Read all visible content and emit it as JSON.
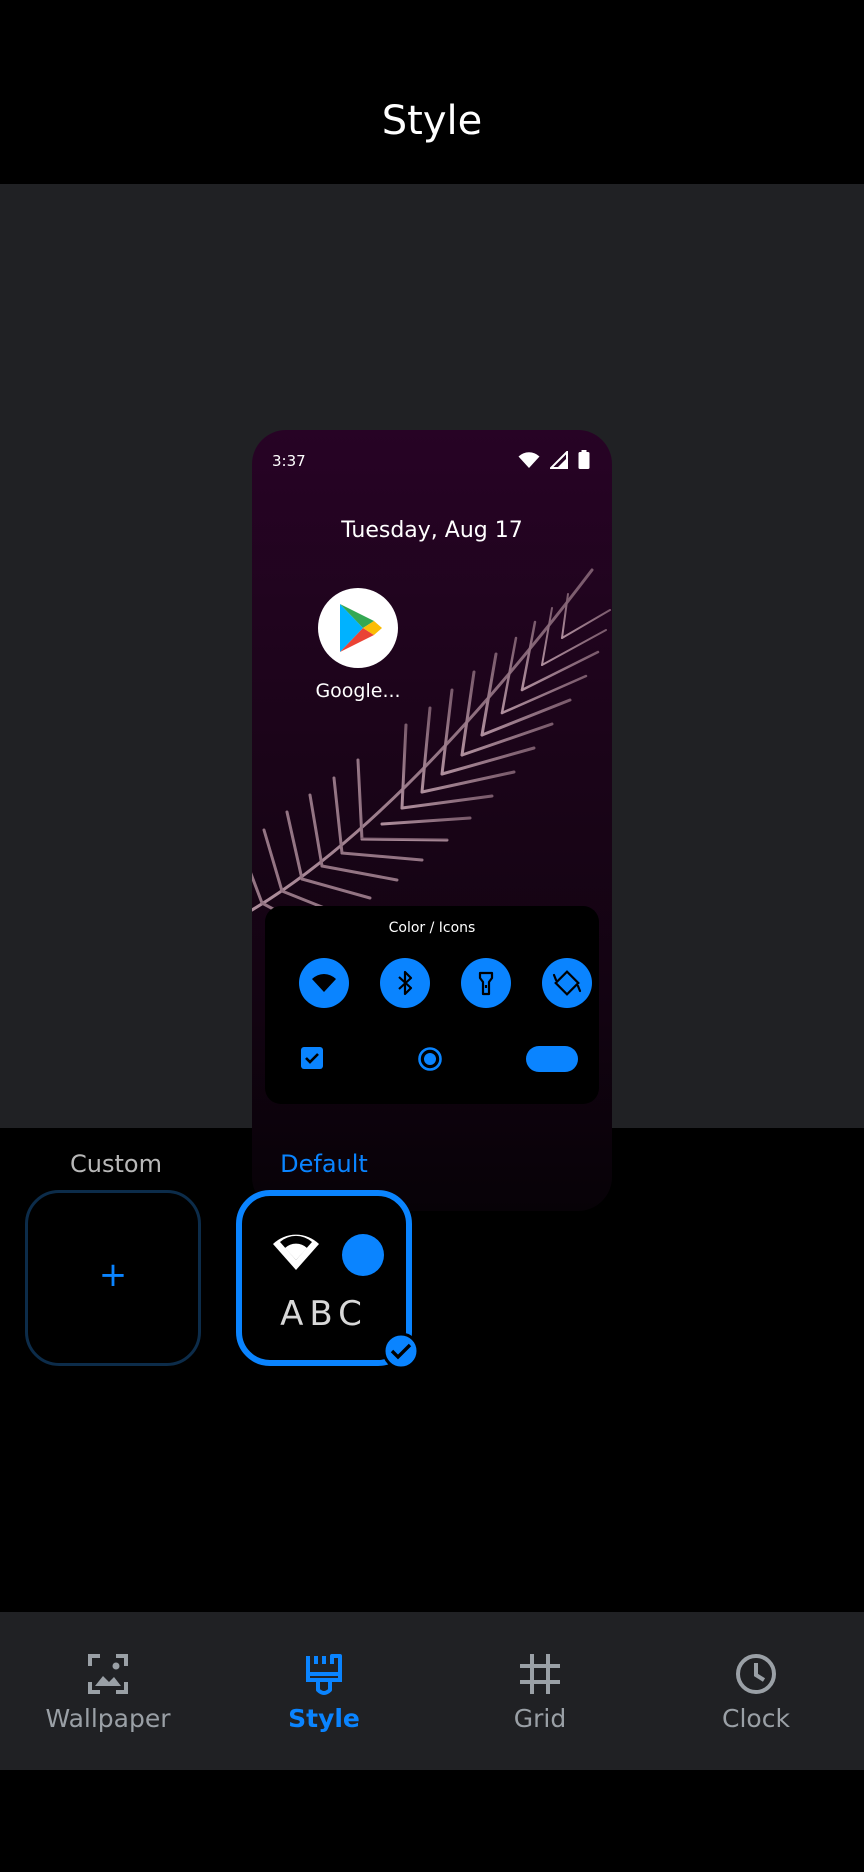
{
  "header": {
    "title": "Style"
  },
  "preview": {
    "time": "3:37",
    "date": "Tuesday, Aug 17",
    "app_label": "Google...",
    "quick_settings_title": "Color / Icons"
  },
  "options": {
    "custom_label": "Custom",
    "default_label": "Default",
    "add_glyph": "+",
    "sample_text": "ABC",
    "selected": "Default"
  },
  "nav": {
    "items": [
      {
        "label": "Wallpaper",
        "icon": "wallpaper-icon",
        "active": false
      },
      {
        "label": "Style",
        "icon": "brush-icon",
        "active": true
      },
      {
        "label": "Grid",
        "icon": "grid-icon",
        "active": false
      },
      {
        "label": "Clock",
        "icon": "clock-icon",
        "active": false
      }
    ]
  },
  "colors": {
    "accent": "#0a84ff",
    "muted": "#9aa0a6",
    "preview_bg": "#202124",
    "nav_bg": "#202124"
  }
}
